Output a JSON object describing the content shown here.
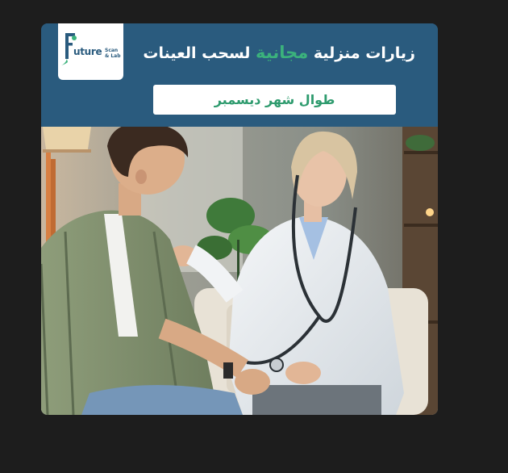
{
  "post": {
    "logo": {
      "word": "uture",
      "sub_line1": "Scan",
      "sub_line2": "& Lab"
    },
    "headline": {
      "part1": "زيارات منزلية",
      "accent": "مجانية",
      "part2": "لسحب العينات"
    },
    "subline": "طوال شهر ديسمبر",
    "colors": {
      "banner": "#2a5b7e",
      "accent_green": "#3bb27c",
      "page_background": "#1d1d1d"
    },
    "photo": {
      "icon": "doctor-patient-photo"
    }
  }
}
